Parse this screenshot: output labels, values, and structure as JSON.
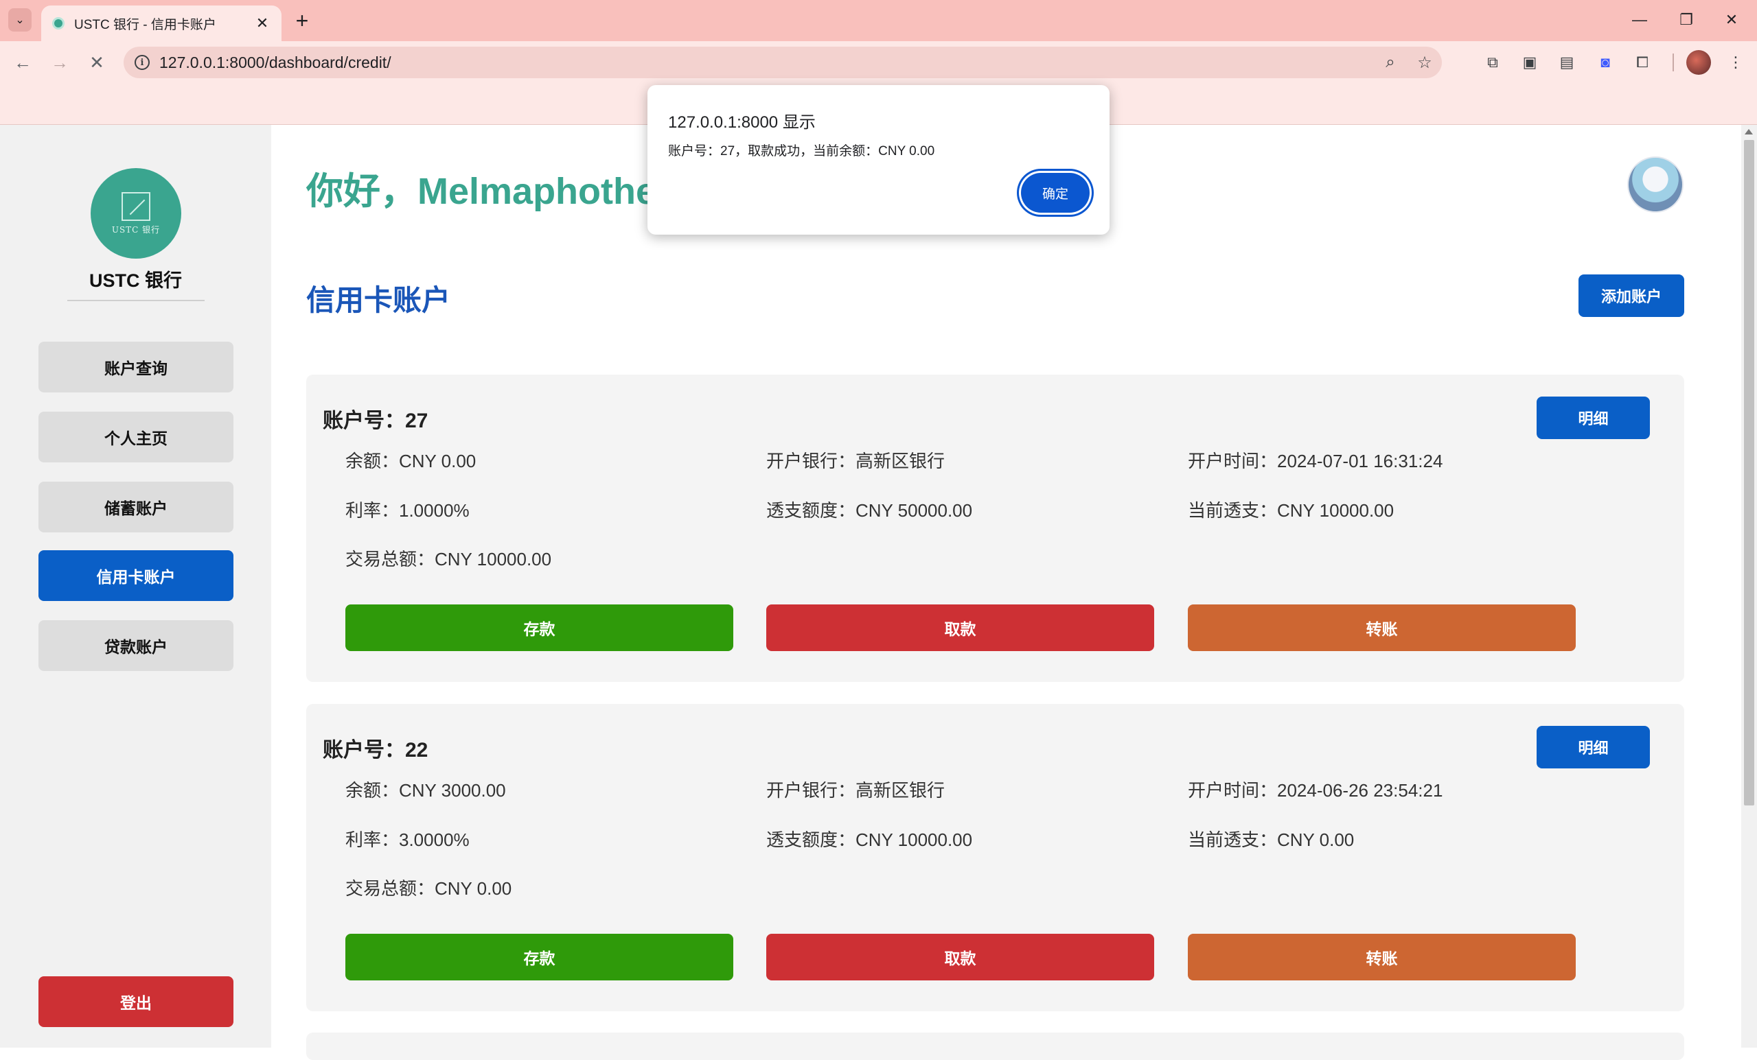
{
  "browser": {
    "tab_title": "USTC 银行 - 信用卡账户",
    "url": "127.0.0.1:8000/dashboard/credit/"
  },
  "sidebar": {
    "logo_text": "USTC 银行",
    "brand": "USTC 银行",
    "items": [
      {
        "label": "账户查询",
        "active": false
      },
      {
        "label": "个人主页",
        "active": false
      },
      {
        "label": "储蓄账户",
        "active": false
      },
      {
        "label": "信用卡账户",
        "active": true
      },
      {
        "label": "贷款账户",
        "active": false
      }
    ],
    "logout_label": "登出"
  },
  "main": {
    "greeting": "你好，Melmaphothe",
    "section_title": "信用卡账户",
    "add_account_label": "添加账户",
    "accounts": [
      {
        "header": "账户号：27",
        "detail_label": "明细",
        "balance": "余额：CNY 0.00",
        "bank": "开户银行：高新区银行",
        "opened": "开户时间：2024-07-01 16:31:24",
        "rate": "利率：1.0000%",
        "overdraft_limit": "透支额度：CNY 50000.00",
        "current_overdraft": "当前透支：CNY 10000.00",
        "total": "交易总额：CNY 10000.00",
        "deposit_label": "存款",
        "withdraw_label": "取款",
        "transfer_label": "转账"
      },
      {
        "header": "账户号：22",
        "detail_label": "明细",
        "balance": "余额：CNY 3000.00",
        "bank": "开户银行：高新区银行",
        "opened": "开户时间：2024-06-26 23:54:21",
        "rate": "利率：3.0000%",
        "overdraft_limit": "透支额度：CNY 10000.00",
        "current_overdraft": "当前透支：CNY 0.00",
        "total": "交易总额：CNY 0.00",
        "deposit_label": "存款",
        "withdraw_label": "取款",
        "transfer_label": "转账"
      }
    ]
  },
  "dialog": {
    "title": "127.0.0.1:8000 显示",
    "message": "账户号：27，取款成功，当前余额：CNY 0.00",
    "ok_label": "确定"
  },
  "colors": {
    "accent_green": "#3aa58f",
    "primary_blue": "#0a5fc7",
    "deposit_green": "#2f9a0a",
    "withdraw_red": "#cd3034",
    "transfer_orange": "#cd6632"
  }
}
